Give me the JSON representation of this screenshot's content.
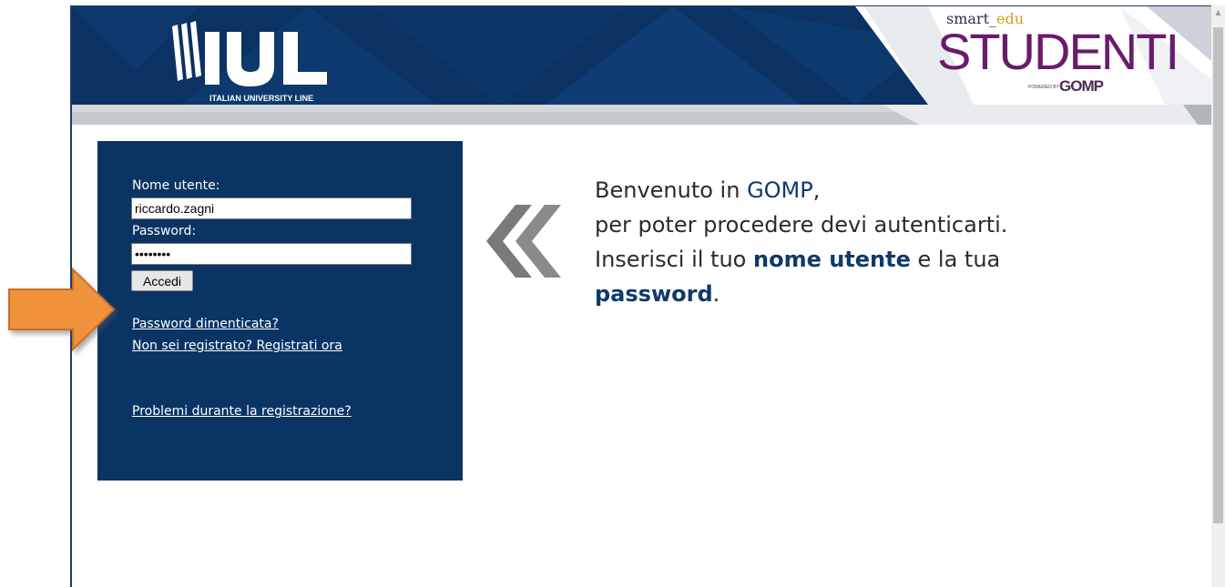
{
  "header": {
    "iul_logo_text": "IUL",
    "iul_tagline": "ITALIAN UNIVERSITY LINE",
    "smart_prefix": "smart",
    "smart_suffix": "edu",
    "product_name": "STUDENTI",
    "powered_by": "POWERED BY",
    "gomp_brand": "GOMP"
  },
  "login": {
    "username_label": "Nome utente:",
    "username_value": "riccardo.zagni",
    "password_label": "Password:",
    "password_value": "••••••••",
    "submit_label": "Accedi",
    "forgot_password_link": "Password dimenticata?",
    "register_link": "Non sei registrato? Registrati ora",
    "problems_link": "Problemi durante la registrazione?"
  },
  "welcome": {
    "line1_prefix": "Benvenuto in ",
    "line1_brand": "GOMP",
    "line1_suffix": ",",
    "line2": "per poter procedere devi autenticarti.",
    "line3_prefix": "Inserisci il tuo ",
    "line3_bold": "nome utente",
    "line3_suffix": " e la tua",
    "line4_bold": "password",
    "line4_suffix": "."
  },
  "colors": {
    "header_navy": "#0a3464",
    "panel_navy": "#0a3464",
    "studenti_purple": "#6a1b6b",
    "edu_gold": "#d4a017",
    "annotation_orange": "#f0923a",
    "chevron_gray": "#7a7a7a"
  },
  "icons": {
    "chevron": "double-chevron-left-icon",
    "annotation": "orange-arrow-right-icon"
  }
}
